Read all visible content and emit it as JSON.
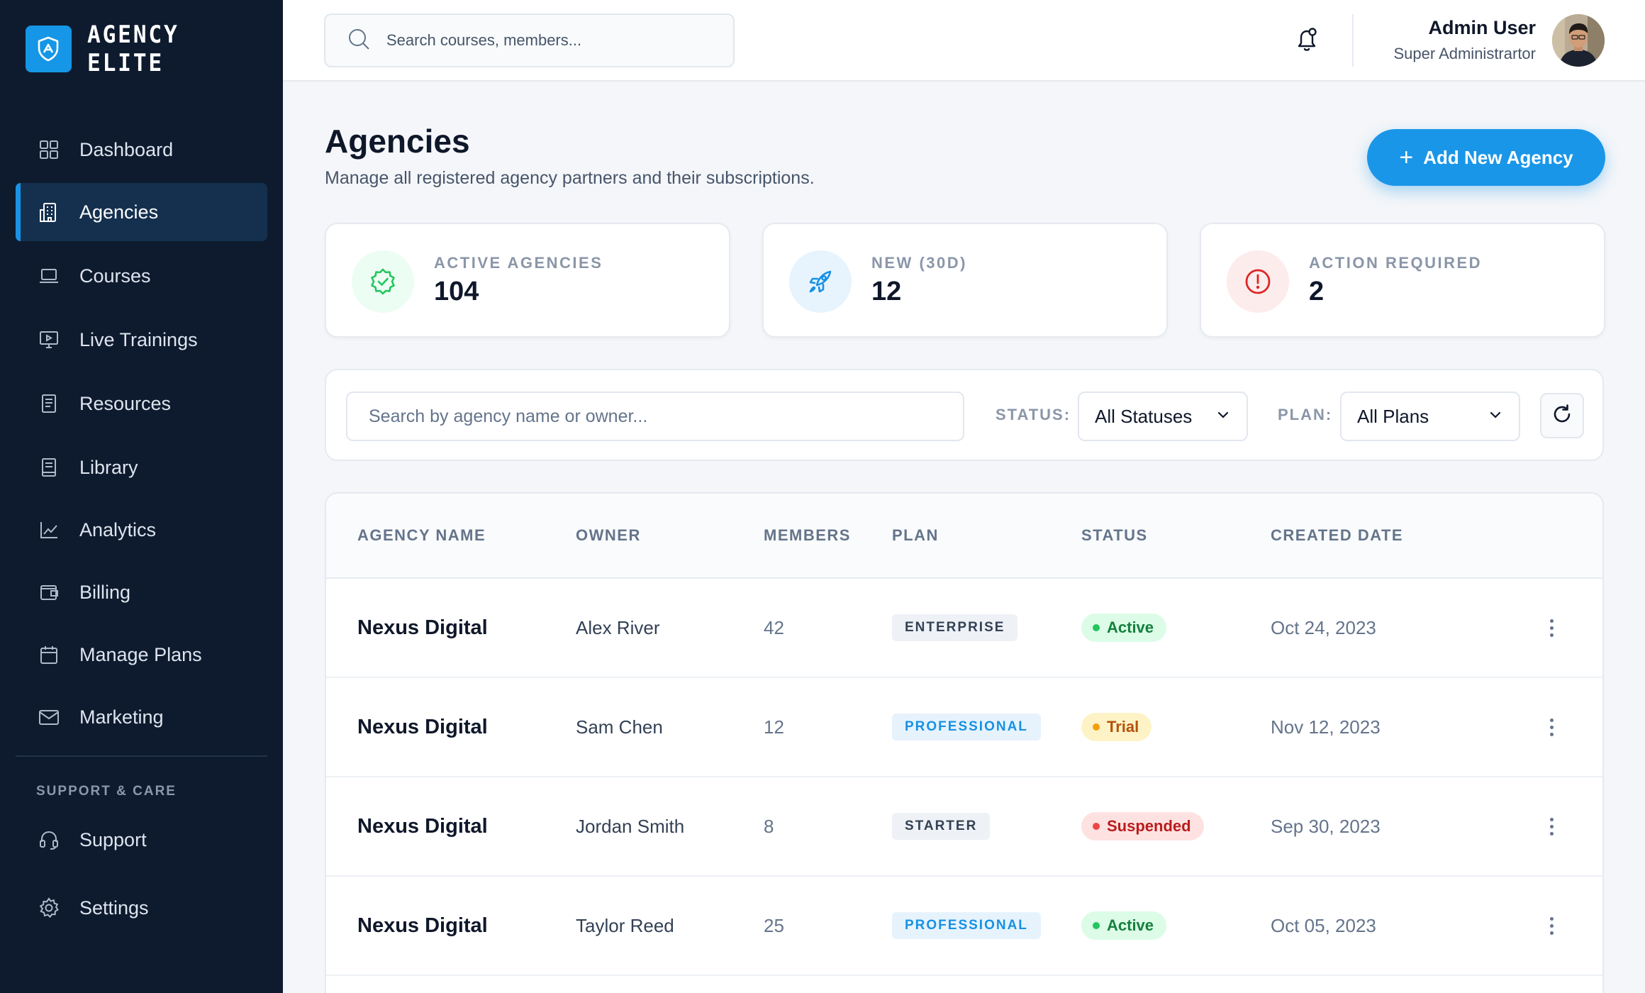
{
  "brand": {
    "name": "AGENCY ELITE",
    "logo_icon": "shield-icon",
    "color": "#1596e6"
  },
  "sidebar": {
    "items": [
      {
        "label": "Dashboard",
        "icon": "grid-icon",
        "active": false
      },
      {
        "label": "Agencies",
        "icon": "building-icon",
        "active": true
      },
      {
        "label": "Courses",
        "icon": "laptop-icon",
        "active": false
      },
      {
        "label": "Live Trainings",
        "icon": "video-screen-icon",
        "active": false
      },
      {
        "label": "Resources",
        "icon": "document-icon",
        "active": false
      },
      {
        "label": "Library",
        "icon": "book-icon",
        "active": false
      },
      {
        "label": "Analytics",
        "icon": "line-chart-icon",
        "active": false
      },
      {
        "label": "Billing",
        "icon": "wallet-icon",
        "active": false
      },
      {
        "label": "Manage Plans",
        "icon": "calendar-icon",
        "active": false
      },
      {
        "label": "Marketing",
        "icon": "mail-icon",
        "active": false
      }
    ],
    "section_label": "SUPPORT & CARE",
    "support_items": [
      {
        "label": "Support",
        "icon": "headset-icon"
      },
      {
        "label": "Settings",
        "icon": "gear-icon"
      }
    ]
  },
  "topbar": {
    "search_placeholder": "Search courses, members...",
    "user_name": "Admin User",
    "user_role": "Super Administrartor"
  },
  "header": {
    "title": "Agencies",
    "subtitle": "Manage all registered agency partners and their subscriptions.",
    "add_button": "Add New Agency",
    "add_button_icon": "+"
  },
  "stats": [
    {
      "label": "ACTIVE AGENCIES",
      "value": "104",
      "icon": "verified-badge-icon",
      "color": "#22c55e",
      "bg": "#ecfdf3"
    },
    {
      "label": "NEW (30D)",
      "value": "12",
      "icon": "rocket-icon",
      "color": "#1791e3",
      "bg": "#e8f4fd"
    },
    {
      "label": "ACTION REQUIRED",
      "value": "2",
      "icon": "alert-circle-icon",
      "color": "#dc2626",
      "bg": "#fdecec"
    }
  ],
  "filters": {
    "search_placeholder": "Search by agency name or owner...",
    "status_label": "STATUS:",
    "status_value": "All Statuses",
    "plan_label": "PLAN:",
    "plan_value": "All Plans"
  },
  "table": {
    "columns": [
      "AGENCY NAME",
      "OWNER",
      "MEMBERS",
      "PLAN",
      "STATUS",
      "CREATED DATE"
    ],
    "rows": [
      {
        "name": "Nexus Digital",
        "owner": "Alex River",
        "members": "42",
        "plan": "ENTERPRISE",
        "status": "Active",
        "created": "Oct 24, 2023"
      },
      {
        "name": "Nexus Digital",
        "owner": "Sam Chen",
        "members": "12",
        "plan": "PROFESSIONAL",
        "status": "Trial",
        "created": "Nov 12, 2023"
      },
      {
        "name": "Nexus Digital",
        "owner": "Jordan Smith",
        "members": "8",
        "plan": "STARTER",
        "status": "Suspended",
        "created": "Sep 30, 2023"
      },
      {
        "name": "Nexus Digital",
        "owner": "Taylor Reed",
        "members": "25",
        "plan": "PROFESSIONAL",
        "status": "Active",
        "created": "Oct 05, 2023"
      }
    ]
  }
}
